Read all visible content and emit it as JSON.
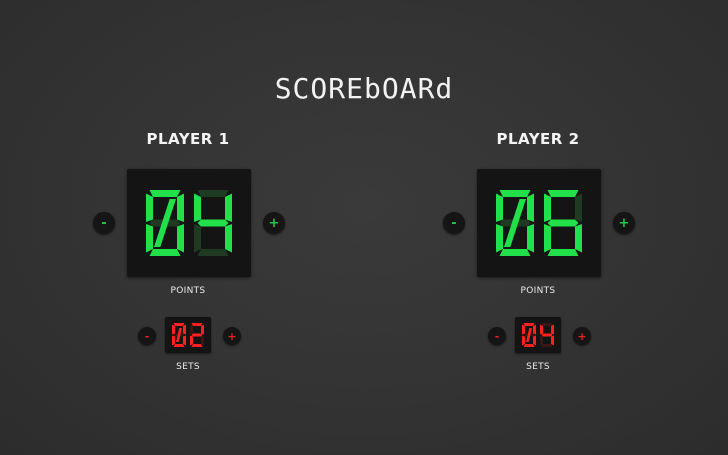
{
  "app": {
    "title": "SCOREbOARd"
  },
  "players": [
    {
      "name": "PLAYER 1",
      "points": "04",
      "sets": "02",
      "points_label": "POINTS",
      "sets_label": "SETS",
      "minus_label": "-",
      "plus_label": "+"
    },
    {
      "name": "PLAYER 2",
      "points": "06",
      "sets": "04",
      "points_label": "POINTS",
      "sets_label": "SETS",
      "minus_label": "-",
      "plus_label": "+"
    }
  ],
  "colors": {
    "background": "#333333",
    "panel": "#141414",
    "points_digit": "#22e04a",
    "sets_digit": "#ff2020",
    "title_text": "#f2f2f2"
  }
}
